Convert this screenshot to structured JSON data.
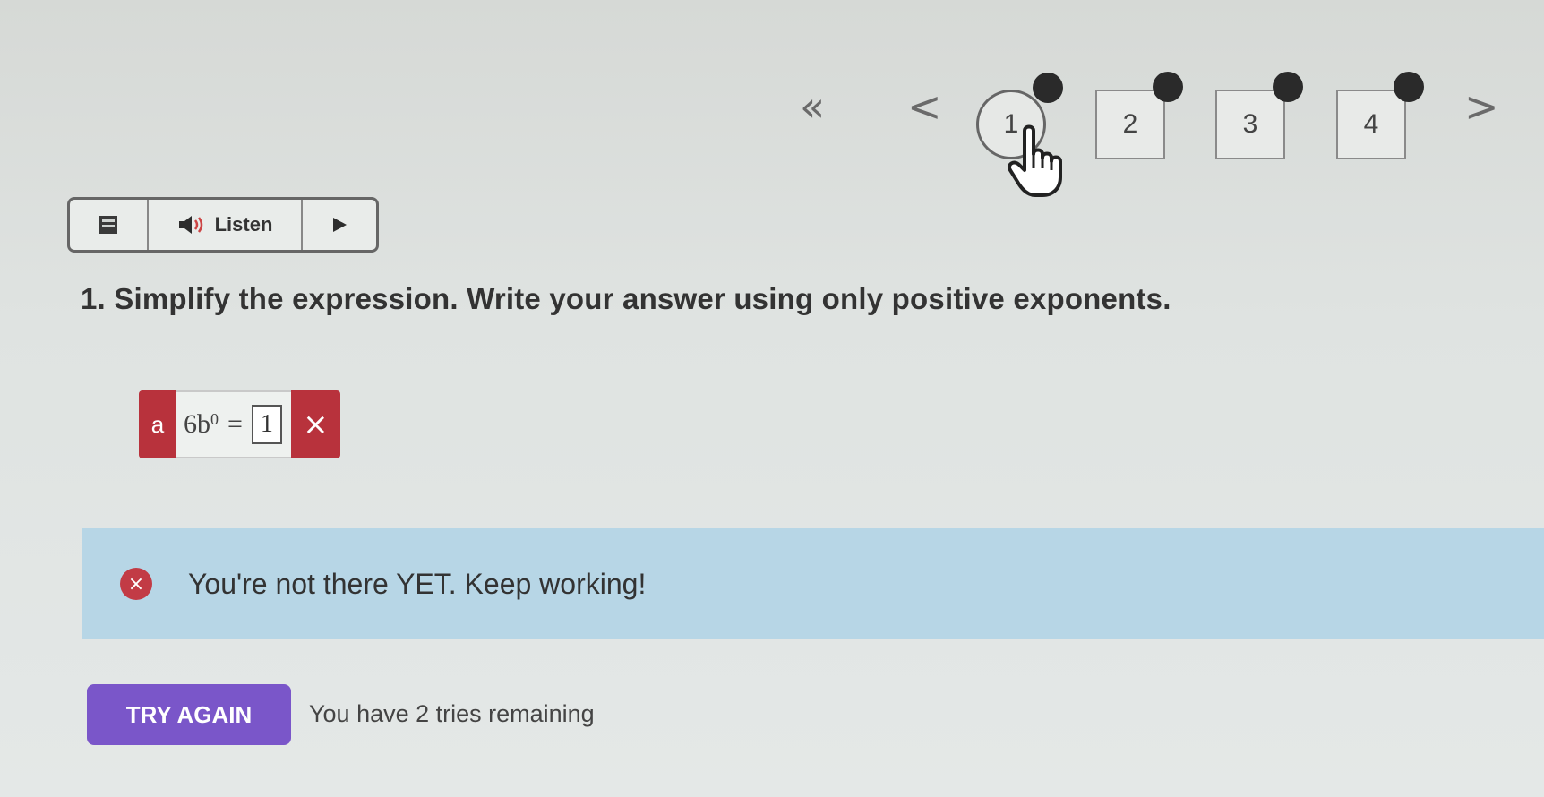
{
  "pagination": {
    "first_glyph": "«",
    "prev_glyph": "<",
    "next_glyph": ">",
    "items": [
      {
        "label": "1",
        "current": true
      },
      {
        "label": "2",
        "current": false
      },
      {
        "label": "3",
        "current": false
      },
      {
        "label": "4",
        "current": false
      }
    ]
  },
  "toolbar": {
    "listen_label": "Listen"
  },
  "question": {
    "text": "1. Simplify the expression. Write your answer using only positive exponents."
  },
  "answer": {
    "part_label": "a",
    "base": "6b",
    "exponent": "0",
    "equals": "=",
    "input_value": "1",
    "status_glyph": "×"
  },
  "feedback": {
    "icon_glyph": "×",
    "message": "You're not there YET. Keep working!"
  },
  "actions": {
    "try_again_label": "TRY AGAIN",
    "tries_text": "You have 2 tries remaining"
  },
  "colors": {
    "error_red": "#b8323c",
    "feedback_blue": "#b7d6e6",
    "button_purple": "#7a56c9"
  }
}
